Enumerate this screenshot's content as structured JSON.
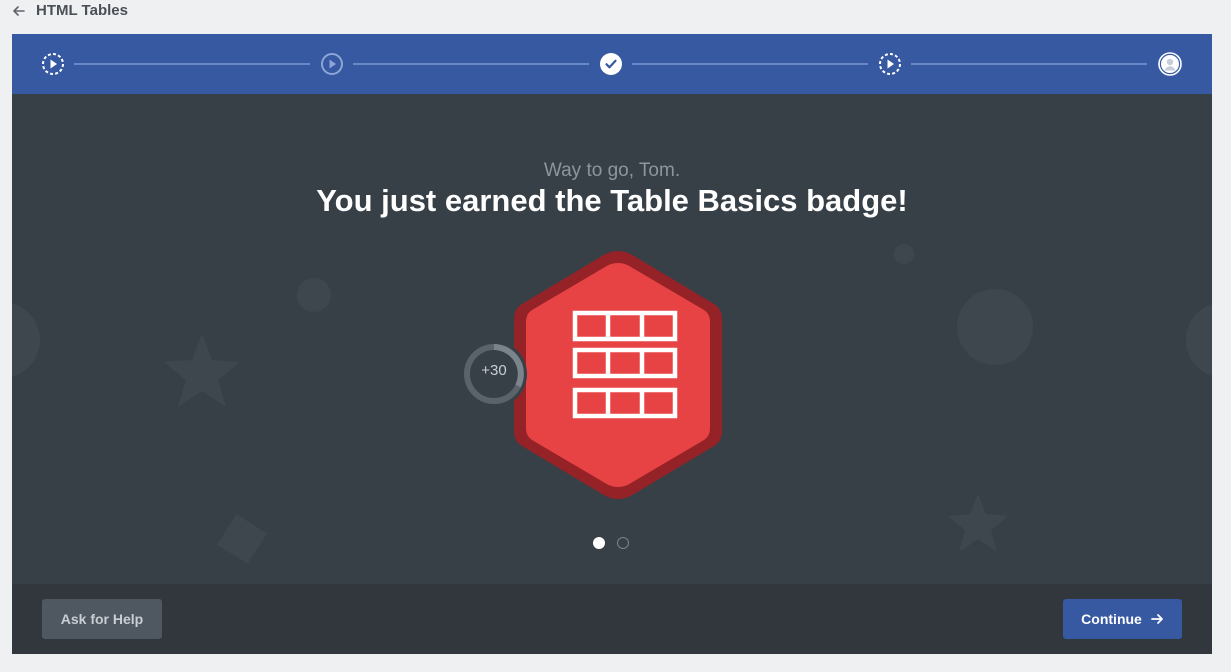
{
  "header": {
    "back_icon": "arrow-left-icon",
    "title": "HTML Tables"
  },
  "progress": {
    "steps": [
      {
        "icon": "play-dashed-icon",
        "state": "in-progress"
      },
      {
        "icon": "play-icon",
        "state": "upcoming"
      },
      {
        "icon": "checkmark-icon",
        "state": "completed"
      },
      {
        "icon": "play-dashed-icon",
        "state": "in-progress"
      },
      {
        "icon": "user-icon",
        "state": "current"
      }
    ]
  },
  "celebration": {
    "greeting": "Way to go, Tom.",
    "headline": "You just earned the Table Basics badge!",
    "points": "+30",
    "badge_icon": "table-grid-icon",
    "badge_colors": {
      "fill": "#e84344",
      "border": "#952226",
      "grid": "#ffffff"
    }
  },
  "pager": {
    "total": 2,
    "active": 1
  },
  "footer": {
    "help_label": "Ask for Help",
    "continue_label": "Continue",
    "continue_icon": "arrow-right-icon"
  },
  "colors": {
    "accent": "#3659a2",
    "panel": "#384047",
    "footer": "#31373d"
  }
}
